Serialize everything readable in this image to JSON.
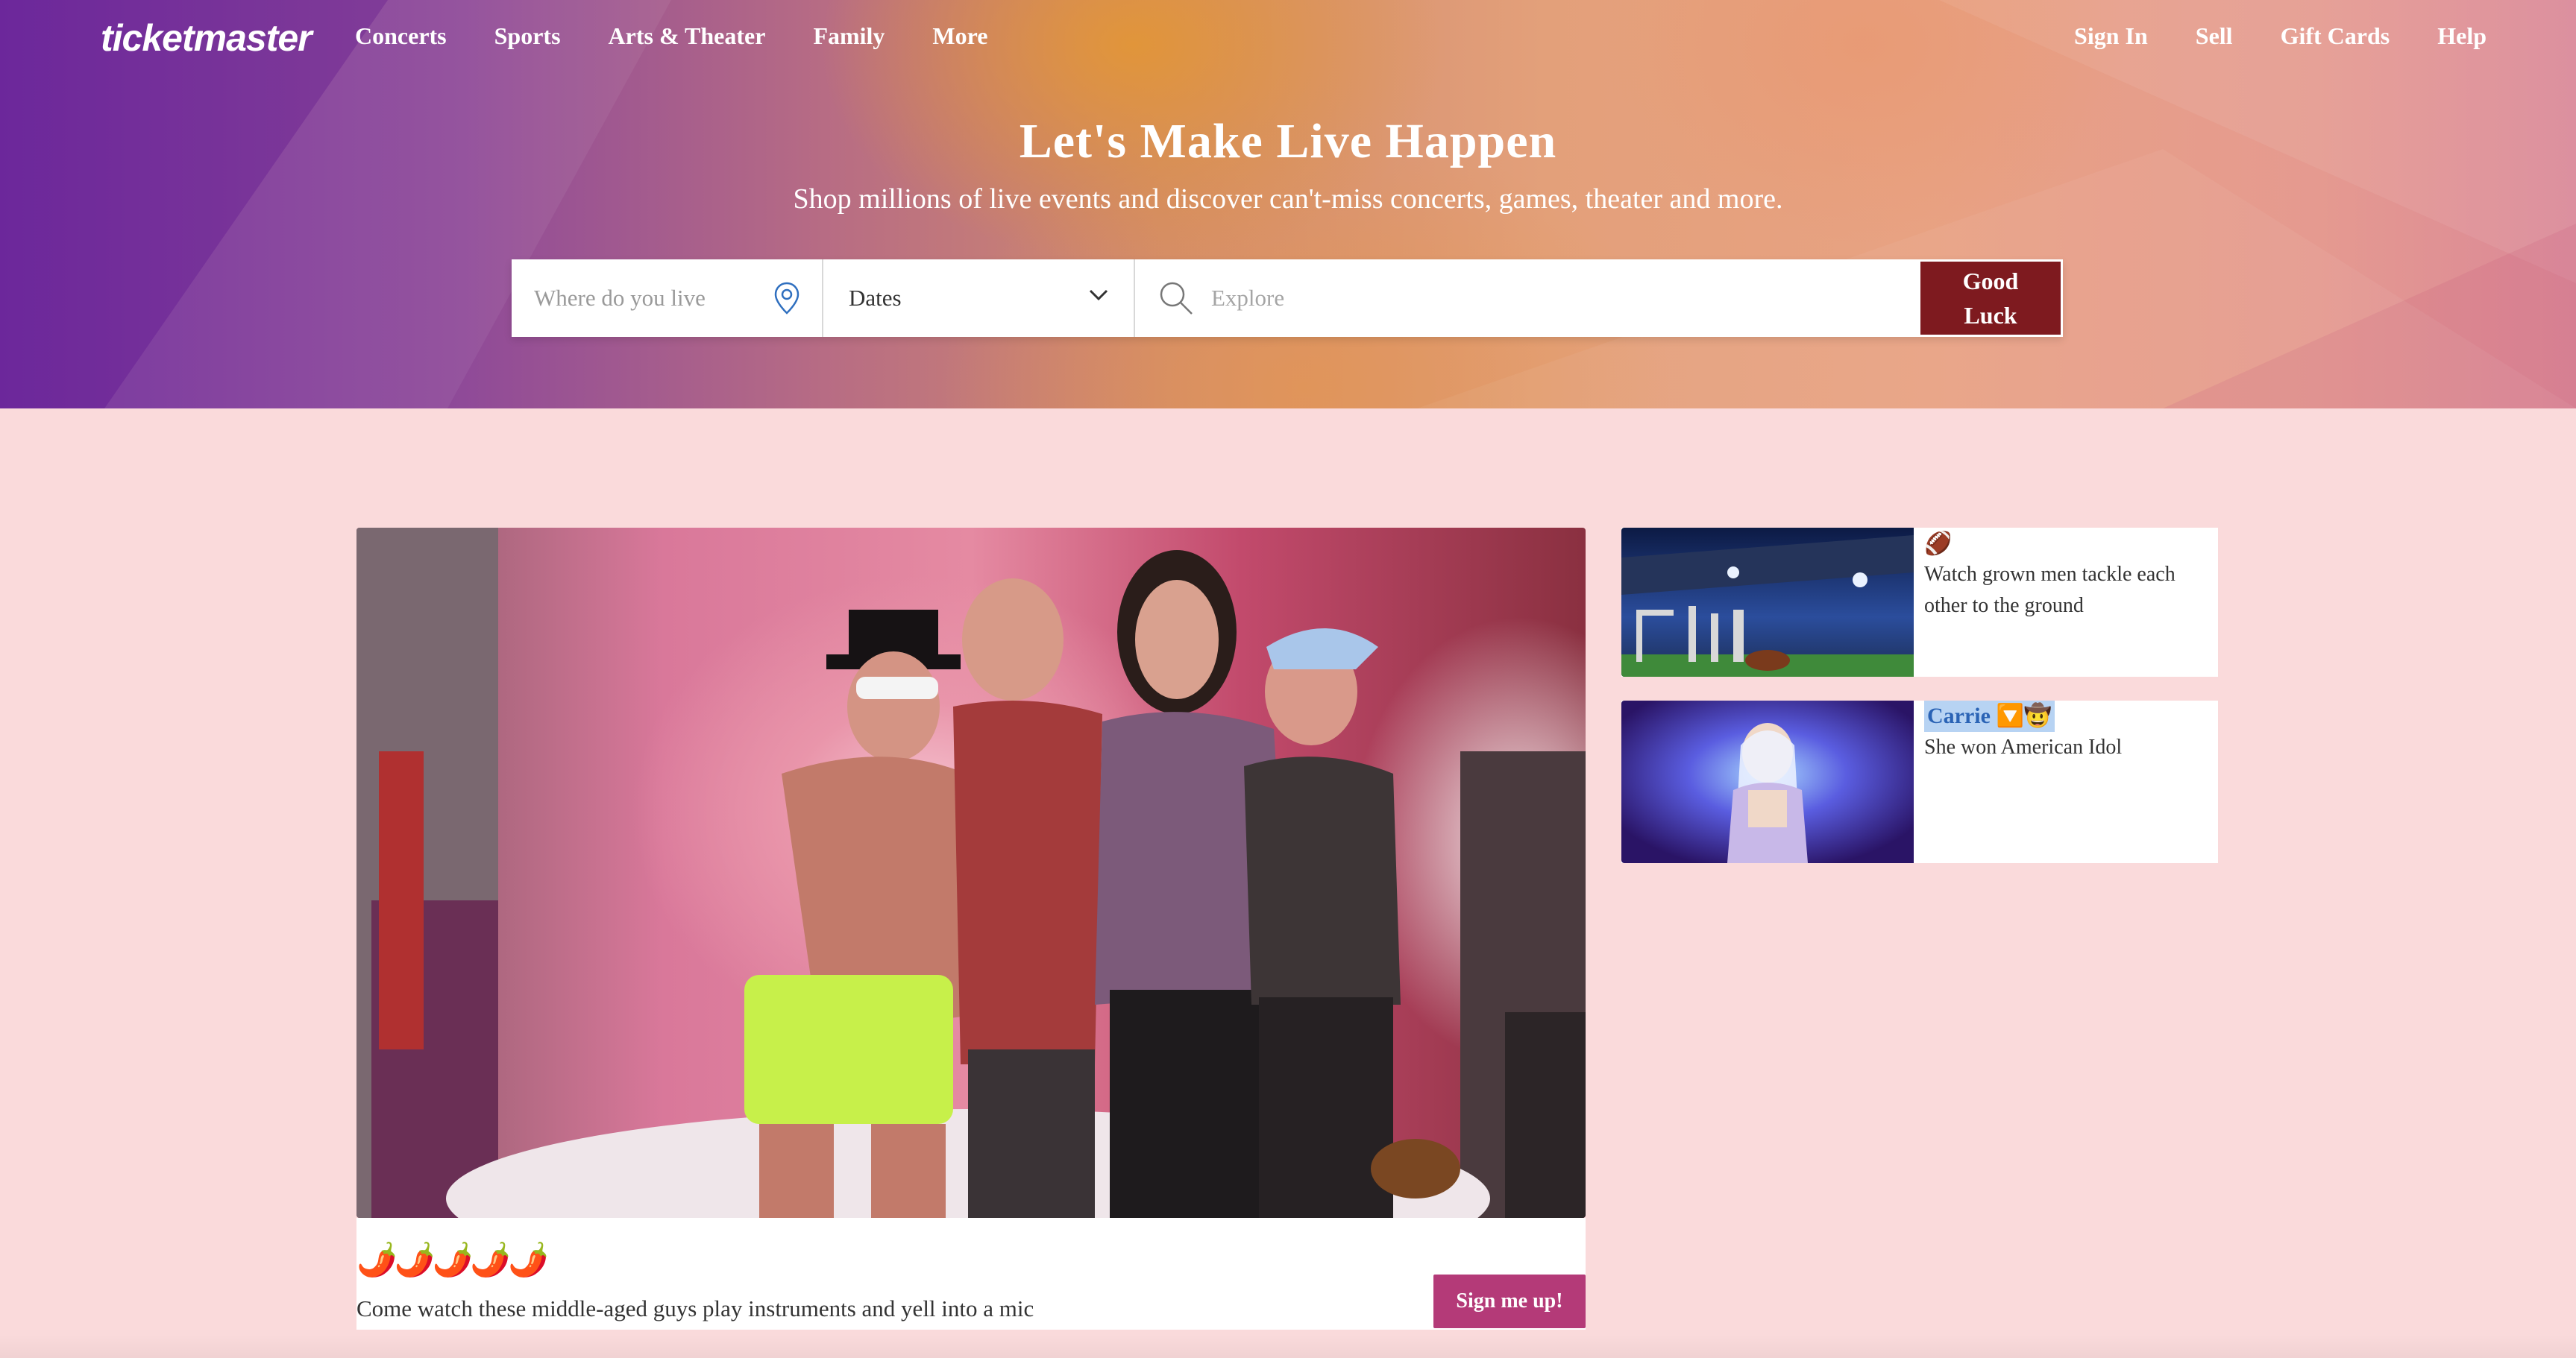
{
  "brand": {
    "logo": "ticketmaster"
  },
  "nav": {
    "left": [
      "Concerts",
      "Sports",
      "Arts & Theater",
      "Family",
      "More"
    ],
    "right": [
      "Sign In",
      "Sell",
      "Gift Cards",
      "Help"
    ]
  },
  "hero": {
    "title": "Let's Make Live Happen",
    "subtitle": "Shop millions of live events and discover can't-miss concerts, games, theater and more."
  },
  "search": {
    "location_placeholder": "Where do you live",
    "dates_value": "Dates",
    "explore_placeholder": "Explore",
    "button_label": "Good Luck"
  },
  "feature": {
    "rating": "🌶️🌶️🌶️🌶️🌶️",
    "description": "Come watch these middle-aged guys play instruments and yell into a mic",
    "cta": "Sign me up!"
  },
  "cards": [
    {
      "emoji": "🏈",
      "text": "Watch grown men tackle each other to the ground"
    },
    {
      "title": "Carrie 🔽🤠",
      "text": "She won American Idol"
    }
  ],
  "colors": {
    "page_bg": "#fadadb",
    "search_button": "#7e1a1f",
    "cta_button": "#b43a78",
    "selection_highlight": "#b7d3f3"
  }
}
